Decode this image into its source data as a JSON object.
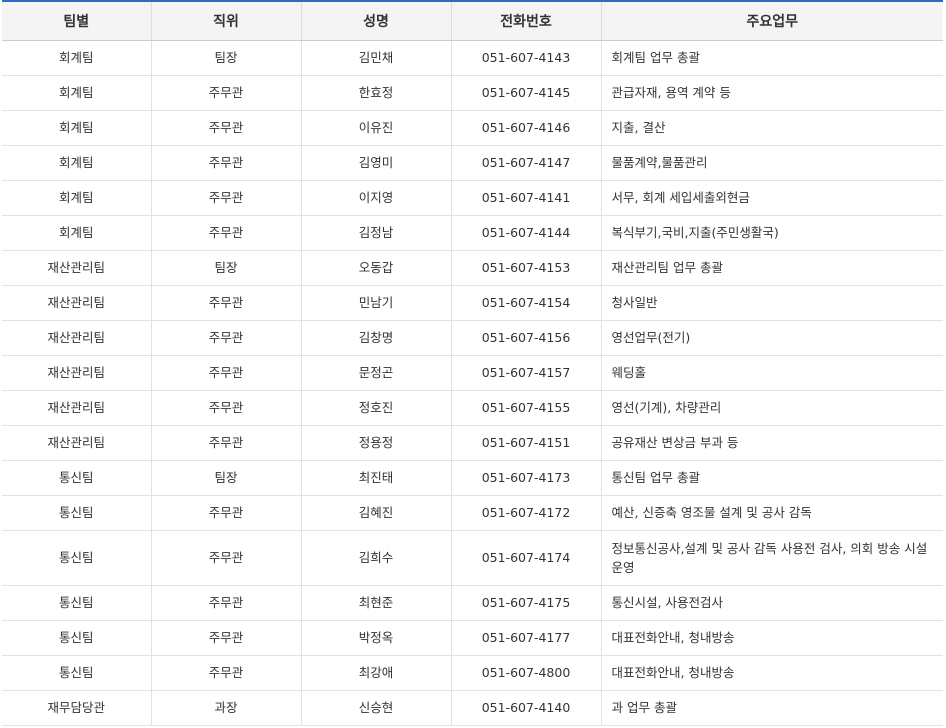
{
  "table": {
    "headers": [
      "팀별",
      "직위",
      "성명",
      "전화번호",
      "주요업무"
    ],
    "rows": [
      {
        "team": "회계팀",
        "position": "팀장",
        "name": "김민채",
        "phone": "051-607-4143",
        "duties": "회계팀 업무 총괄"
      },
      {
        "team": "회계팀",
        "position": "주무관",
        "name": "한효정",
        "phone": "051-607-4145",
        "duties": "관급자재, 용역 계약 등"
      },
      {
        "team": "회계팀",
        "position": "주무관",
        "name": "이유진",
        "phone": "051-607-4146",
        "duties": "지출, 결산"
      },
      {
        "team": "회계팀",
        "position": "주무관",
        "name": "김영미",
        "phone": "051-607-4147",
        "duties": "물품계약,물품관리"
      },
      {
        "team": "회계팀",
        "position": "주무관",
        "name": "이지영",
        "phone": "051-607-4141",
        "duties": "서무, 회계 세입세출외현금"
      },
      {
        "team": "회계팀",
        "position": "주무관",
        "name": "김정남",
        "phone": "051-607-4144",
        "duties": "복식부기,국비,지출(주민생활국)"
      },
      {
        "team": "재산관리팀",
        "position": "팀장",
        "name": "오동갑",
        "phone": "051-607-4153",
        "duties": "재산관리팀 업무 총괄"
      },
      {
        "team": "재산관리팀",
        "position": "주무관",
        "name": "민남기",
        "phone": "051-607-4154",
        "duties": "청사일반"
      },
      {
        "team": "재산관리팀",
        "position": "주무관",
        "name": "김창명",
        "phone": "051-607-4156",
        "duties": "영선업무(전기)"
      },
      {
        "team": "재산관리팀",
        "position": "주무관",
        "name": "문정곤",
        "phone": "051-607-4157",
        "duties": "웨딩홀"
      },
      {
        "team": "재산관리팀",
        "position": "주무관",
        "name": "정호진",
        "phone": "051-607-4155",
        "duties": "영선(기계), 차량관리"
      },
      {
        "team": "재산관리팀",
        "position": "주무관",
        "name": "정용정",
        "phone": "051-607-4151",
        "duties": "공유재산 변상금 부과 등"
      },
      {
        "team": "통신팀",
        "position": "팀장",
        "name": "최진태",
        "phone": "051-607-4173",
        "duties": "통신팀 업무 총괄"
      },
      {
        "team": "통신팀",
        "position": "주무관",
        "name": "김혜진",
        "phone": "051-607-4172",
        "duties": "예산, 신증축 영조물 설계 및 공사 감독"
      },
      {
        "team": "통신팀",
        "position": "주무관",
        "name": "김희수",
        "phone": "051-607-4174",
        "duties": "정보통신공사,설계 및 공사 감독 사용전 검사, 의회 방송 시설 운영"
      },
      {
        "team": "통신팀",
        "position": "주무관",
        "name": "최현준",
        "phone": "051-607-4175",
        "duties": "통신시설, 사용전검사"
      },
      {
        "team": "통신팀",
        "position": "주무관",
        "name": "박정옥",
        "phone": "051-607-4177",
        "duties": "대표전화안내, 청내방송"
      },
      {
        "team": "통신팀",
        "position": "주무관",
        "name": "최강애",
        "phone": "051-607-4800",
        "duties": "대표전화안내, 청내방송"
      },
      {
        "team": "재무담당관",
        "position": "과장",
        "name": "신승현",
        "phone": "051-607-4140",
        "duties": "과 업무 총괄"
      }
    ]
  },
  "colors": {
    "accent_top_border": "#2f6bc4",
    "header_background": "#f4f4f4",
    "grid_line": "#e2e2e2"
  }
}
